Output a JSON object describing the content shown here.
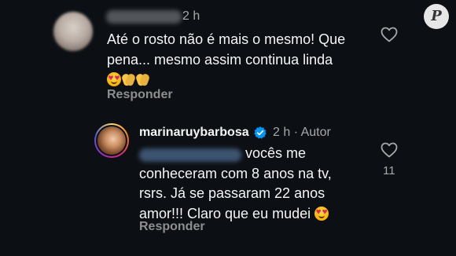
{
  "comment1": {
    "time": "2 h",
    "text_line1": "Até o rosto não é mais o mesmo! Que",
    "text_line2": "pena... mesmo assim continua linda",
    "reply_label": "Responder"
  },
  "comment2": {
    "username": "marinaruybarbosa",
    "meta": "2 h · Autor",
    "text_line1": "vocês me",
    "text_line2": "conheceram com 8 anos na tv,",
    "text_line3": "rsrs. Já se passaram 22 anos",
    "text_line4": "amor!!! Claro que eu mudei",
    "like_count": "11",
    "reply_label": "Responder"
  },
  "logo_letter": "P",
  "colors": {
    "background": "#0c1014",
    "text": "#f5f5f5",
    "muted": "#a8a8a8",
    "verified": "#0095f6"
  },
  "icons": [
    "heart-outline-icon",
    "verified-badge-icon"
  ]
}
